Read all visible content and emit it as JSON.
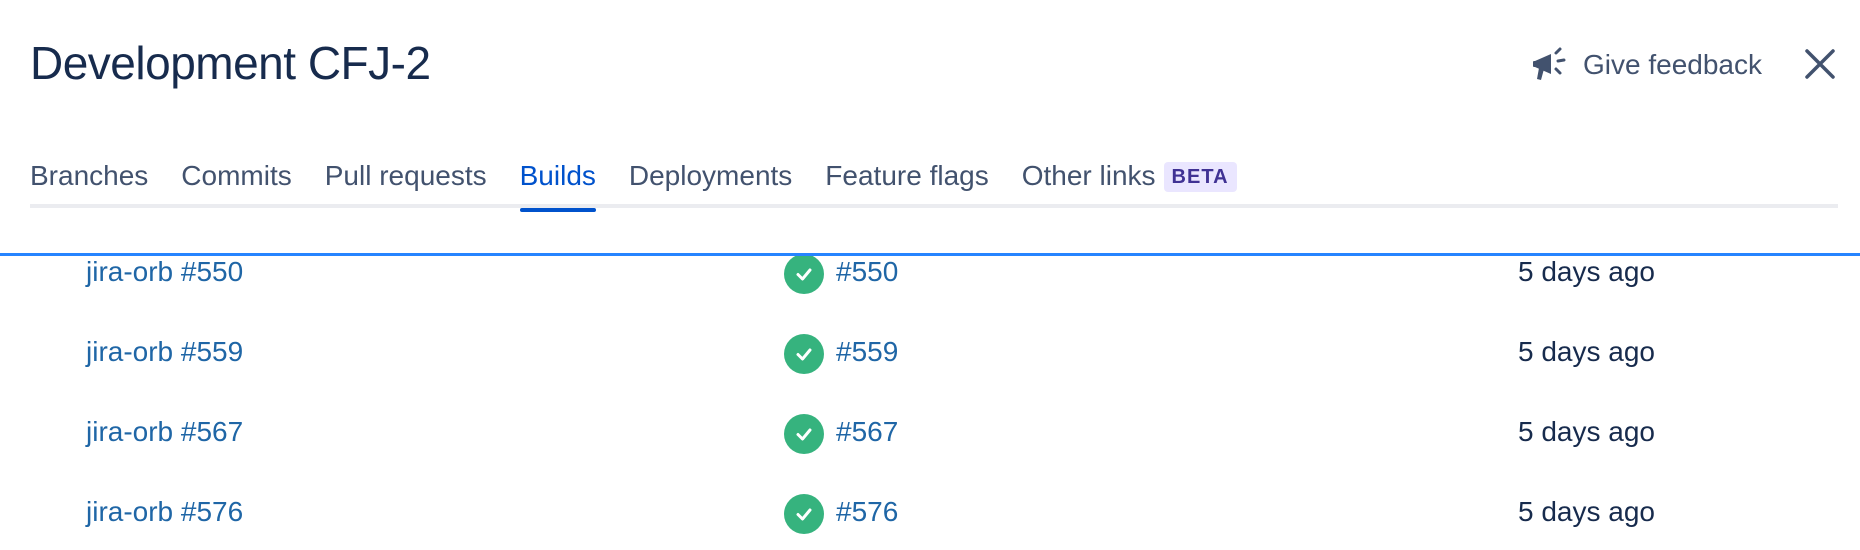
{
  "header": {
    "title": "Development CFJ-2",
    "feedback_label": "Give feedback",
    "feedback_icon": "megaphone-icon",
    "close_icon": "close-icon"
  },
  "tabs": [
    {
      "label": "Branches",
      "active": false
    },
    {
      "label": "Commits",
      "active": false
    },
    {
      "label": "Pull requests",
      "active": false
    },
    {
      "label": "Builds",
      "active": true
    },
    {
      "label": "Deployments",
      "active": false
    },
    {
      "label": "Feature flags",
      "active": false
    },
    {
      "label": "Other links",
      "active": false,
      "badge": "BETA"
    }
  ],
  "builds": [
    {
      "name": "jira-orb #550",
      "status": "success",
      "build": "#550",
      "time": "5 days ago"
    },
    {
      "name": "jira-orb #559",
      "status": "success",
      "build": "#559",
      "time": "5 days ago"
    },
    {
      "name": "jira-orb #567",
      "status": "success",
      "build": "#567",
      "time": "5 days ago"
    },
    {
      "name": "jira-orb #576",
      "status": "success",
      "build": "#576",
      "time": "5 days ago"
    }
  ],
  "colors": {
    "title": "#172b4d",
    "tab_active": "#0052cc",
    "link": "#1f66a6",
    "success": "#36b37e",
    "beta_bg": "#eae6ff",
    "beta_text": "#403294",
    "scroll_indicator": "#2684ff"
  }
}
